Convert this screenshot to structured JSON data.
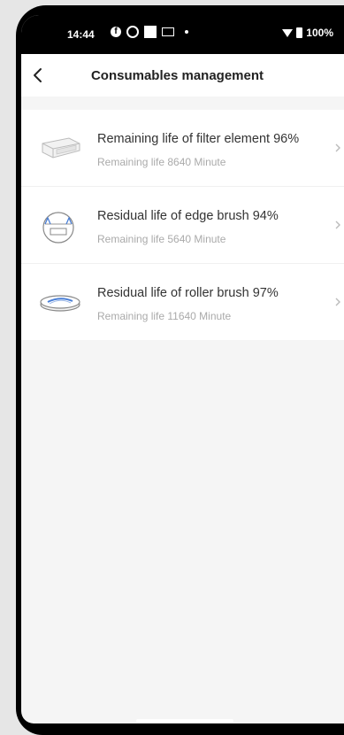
{
  "status_bar": {
    "time": "14:44",
    "battery": "100%",
    "icons": [
      "facebook-icon",
      "ring-icon",
      "square-icon",
      "mail-icon",
      "dot-icon",
      "wifi-icon",
      "battery-icon"
    ]
  },
  "nav": {
    "title": "Consumables management",
    "back_icon": "chevron-left-icon"
  },
  "consumables": [
    {
      "title": "Remaining life of filter element 96%",
      "subtitle": "Remaining life 8640 Minute",
      "icon": "filter-element-icon"
    },
    {
      "title": "Residual life of edge brush 94%",
      "subtitle": "Remaining life 5640 Minute",
      "icon": "edge-brush-icon"
    },
    {
      "title": "Residual life of roller brush 97%",
      "subtitle": "Remaining life 11640 Minute",
      "icon": "roller-brush-icon"
    }
  ],
  "colors": {
    "background": "#f5f5f5",
    "card": "#ffffff",
    "title": "#333333",
    "subtitle": "#aaaaaa",
    "accent_blue": "#4a7fd6"
  }
}
